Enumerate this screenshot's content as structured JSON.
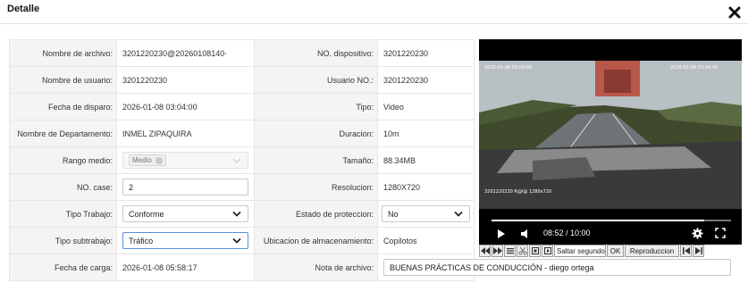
{
  "header": {
    "title": "Detalle"
  },
  "left": [
    {
      "label": "Nombre de archivo:",
      "value": "3201220230@20260108140·"
    },
    {
      "label": "Nombre de usuario:",
      "value": "3201220230"
    },
    {
      "label": "Fecha de disparo:",
      "value": "2026-01-08 03:04:00"
    },
    {
      "label": "Nombre de Departamento:",
      "value": "INMEL ZIPAQUIRA"
    },
    {
      "label": "Rango medio:",
      "chip": "Medio"
    },
    {
      "label": "NO. case:",
      "value": "2"
    },
    {
      "label": "Tipo Trabajo:",
      "value": "Conforme"
    },
    {
      "label": "Tipo subtrabajo:",
      "value": "Tráfico"
    },
    {
      "label": "Fecha de carga:",
      "value": "2026-01-08 05:58:17"
    }
  ],
  "right": [
    {
      "label": "NO. dispositivo:",
      "value": "3201220230"
    },
    {
      "label": "Usuario NO.:",
      "value": "3201220230"
    },
    {
      "label": "Tipo:",
      "value": "Video"
    },
    {
      "label": "Duracion:",
      "value": "10m"
    },
    {
      "label": "Tamaño:",
      "value": "88.34MB"
    },
    {
      "label": "Resolucion:",
      "value": "1280X720"
    },
    {
      "label": "Estado de proteccion:",
      "value": "No"
    },
    {
      "label": "Ubicacion de almacenamiento:",
      "value": "Copilotos"
    },
    {
      "label": "Nota de archivo:",
      "value": "BUENAS PRÁCTICAS DE CONDUCCIÓN - diego ortega"
    }
  ],
  "video": {
    "time": "08:52 / 10:00",
    "progress": 0.887,
    "icons": [
      "play-icon",
      "volume-icon",
      "settings-gear-icon",
      "fullscreen-icon"
    ]
  },
  "toolbar": {
    "seek_placeholder": "Saltar segundo",
    "ok_label": "OK",
    "replay_label": "Reproduccion"
  },
  "colors": {
    "label_bg": "#f4f4f4",
    "border": "#e6e6e6",
    "focus": "#5b8fd6"
  }
}
